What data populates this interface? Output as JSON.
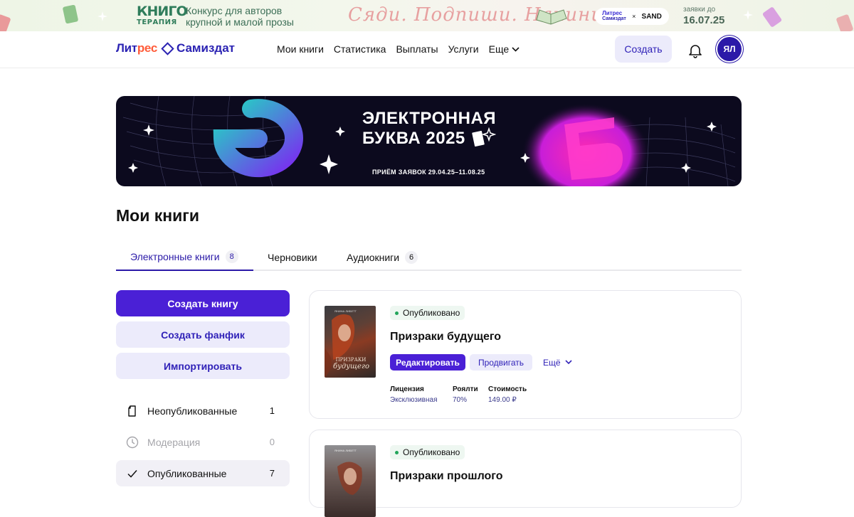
{
  "promo": {
    "logo_top": "КНИГО",
    "logo_bottom": "ТЕРАПИЯ",
    "text": "Конкурс для авторов крупной и малой прозы",
    "script_text": "Сяди. Подпиши. Начини",
    "partner_litres": "Литрес",
    "partner_samizdat": "Самиздат",
    "partner_x": "×",
    "partner_brand": "SAND",
    "deadline_label": "заявки до",
    "deadline_date": "16.07.25"
  },
  "header": {
    "brand_litres_a": "Лит",
    "brand_litres_b": "рес",
    "brand_samizdat": "Самиздат",
    "nav": [
      "Мои книги",
      "Статистика",
      "Выплаты",
      "Услуги",
      "Еще"
    ],
    "create_label": "Создать",
    "avatar_initials": "ЯЛ"
  },
  "hero": {
    "title_line1": "ЭЛЕКТРОННАЯ",
    "title_line2": "БУКВА 2025",
    "subtitle": "ПРИЁМ ЗАЯВОК 29.04.25–11.08.25"
  },
  "page_title": "Мои книги",
  "tabs": [
    {
      "label": "Электронные книги",
      "count": "8"
    },
    {
      "label": "Черновики",
      "count": ""
    },
    {
      "label": "Аудиокниги",
      "count": "6"
    }
  ],
  "actions": {
    "create_book": "Создать книгу",
    "create_fanfic": "Создать фанфик",
    "import": "Импортировать"
  },
  "filters": [
    {
      "label": "Неопубликованные",
      "count": "1",
      "icon": "document-icon"
    },
    {
      "label": "Модерация",
      "count": "0",
      "icon": "clock-icon"
    },
    {
      "label": "Опубликованные",
      "count": "7",
      "icon": "check-icon"
    }
  ],
  "books": [
    {
      "status": "Опубликовано",
      "title": "Призраки будущего",
      "cover_author": "ЯНИНА ЛИБЕТТ",
      "cover_title_a": "ПРИЗРАКИ",
      "cover_title_b": "будущего",
      "edit_label": "Редактировать",
      "promote_label": "Продвигать",
      "more_label": "Ещё",
      "license_h": "Лицензия",
      "license_v": "Эксклюзивная",
      "royalty_h": "Роялти",
      "royalty_v": "70%",
      "price_h": "Стоимость",
      "price_v": "149.00 ₽"
    },
    {
      "status": "Опубликовано",
      "title": "Призраки прошлого",
      "cover_author": "ЯНИНА ЛИБЕТТ"
    }
  ],
  "colors": {
    "brand": "#2b1aa8",
    "primary_button": "#4a20d6",
    "secondary_button": "#ecebfb",
    "status_green": "#22a55a"
  }
}
